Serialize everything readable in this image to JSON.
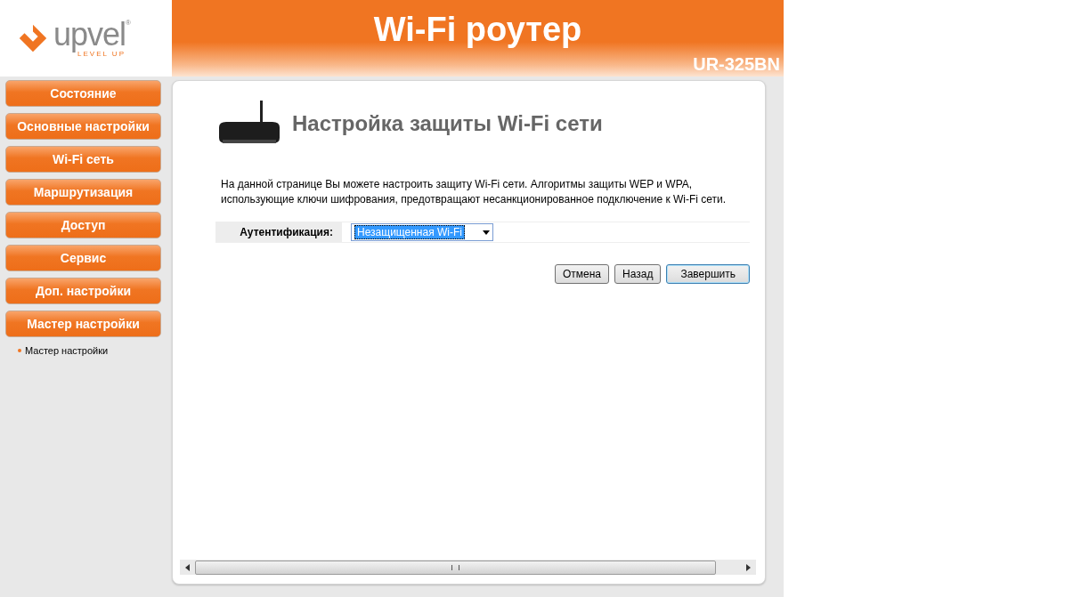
{
  "logo": {
    "name": "upvel",
    "mark": "®",
    "tagline": "LEVEL UP"
  },
  "header": {
    "title": "Wi-Fi роутер",
    "model": "UR-325BN"
  },
  "sidebar": {
    "items": [
      {
        "label": "Состояние"
      },
      {
        "label": "Основные настройки"
      },
      {
        "label": "Wi-Fi сеть"
      },
      {
        "label": "Маршрутизация"
      },
      {
        "label": "Доступ"
      },
      {
        "label": "Сервис"
      },
      {
        "label": "Доп. настройки"
      },
      {
        "label": "Мастер настройки"
      }
    ],
    "subitems": [
      {
        "label": "Мастер настройки"
      }
    ]
  },
  "page": {
    "title": "Настройка защиты Wi-Fi сети",
    "description": "На данной странице Вы можете настроить защиту Wi-Fi сети. Алгоритмы защиты WEP и WPA, использующие ключи шифрования, предотвращают несанкционированное подключение к Wi-Fi сети.",
    "form": {
      "label": "Аутентификация:",
      "value": "Незащищенная Wi-Fi"
    },
    "buttons": [
      {
        "label": "Отмена",
        "kind": "plain"
      },
      {
        "label": "Назад",
        "kind": "plain"
      },
      {
        "label": "Завершить",
        "kind": "default"
      }
    ]
  }
}
